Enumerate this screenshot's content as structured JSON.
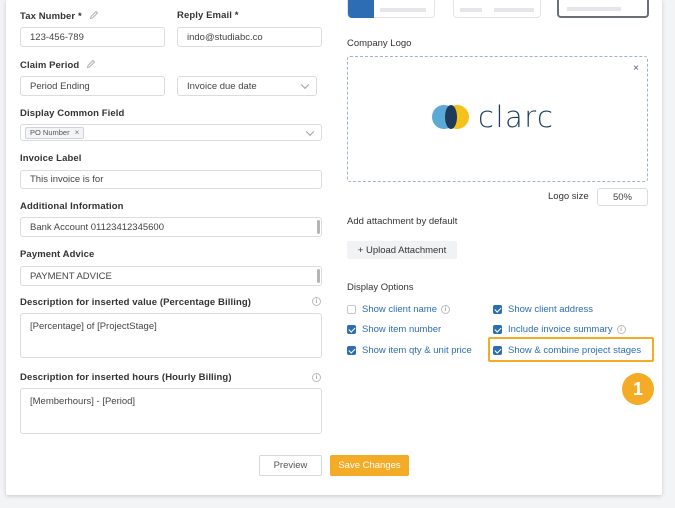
{
  "left": {
    "tax_number": {
      "label": "Tax Number *",
      "value": "123-456-789"
    },
    "reply_email": {
      "label": "Reply Email *",
      "value": "indo@studiabc.co"
    },
    "claim_period": {
      "label": "Claim Period",
      "value": "Period Ending",
      "select_value": "Invoice due date"
    },
    "display_common_field": {
      "label": "Display Common Field",
      "tag": "PO Number",
      "tag_remove": "×"
    },
    "invoice_label": {
      "label": "Invoice Label",
      "value": "This invoice is for"
    },
    "additional_information": {
      "label": "Additional Information",
      "value": "Bank Account 01123412345600"
    },
    "payment_advice": {
      "label": "Payment Advice",
      "value": "PAYMENT ADVICE"
    },
    "desc_value": {
      "label": "Description for inserted value (Percentage Billing)",
      "value": "[Percentage] of [ProjectStage]"
    },
    "desc_hours": {
      "label": "Description for inserted hours (Hourly Billing)",
      "value": "[Memberhours] - [Period]"
    }
  },
  "right": {
    "company_logo_label": "Company Logo",
    "logo_close": "×",
    "logo_text": "clarc",
    "logo_size_label": "Logo size",
    "logo_size_value": "50%",
    "attachment_label": "Add attachment by default",
    "upload_button": "+ Upload Attachment",
    "display_options_label": "Display Options",
    "options": {
      "show_client_name": "Show client name",
      "show_client_address": "Show client address",
      "show_item_number": "Show item number",
      "include_invoice_summary": "Include invoice summary",
      "show_item_qty": "Show item qty & unit price",
      "show_combine_stages": "Show & combine project stages"
    }
  },
  "footer": {
    "preview": "Preview",
    "save": "Save Changes"
  },
  "callout": {
    "number": "1"
  },
  "colors": {
    "accent": "#f4ab25",
    "link": "#2d6db3",
    "logo_dark": "#1f3b5c",
    "logo_yellow": "#f4c21a"
  }
}
